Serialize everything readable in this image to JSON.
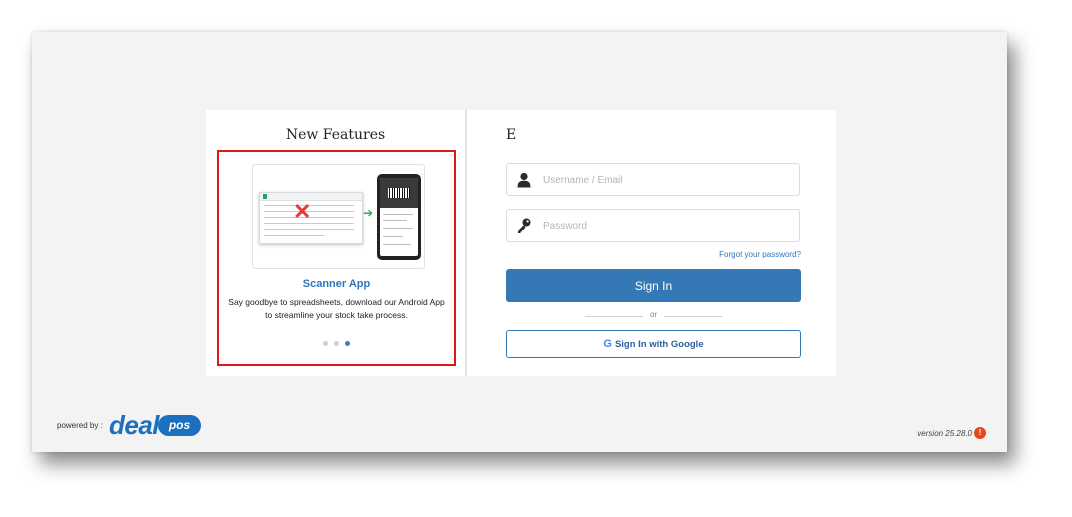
{
  "features": {
    "title": "New Features",
    "item_title": "Scanner App",
    "item_description": "Say goodbye to spreadsheets, download our Android App to streamline your stock take process.",
    "slide_count": 3,
    "active_slide": 3
  },
  "signin": {
    "brand_letter": "E",
    "username_placeholder": "Username / Email",
    "password_placeholder": "Password",
    "forgot_label": "Forgot your password?",
    "signin_label": "Sign In",
    "or_label": "or",
    "google_label": "Sign In with Google"
  },
  "footer": {
    "powered_by": "powered by :",
    "logo_deal": "deal",
    "logo_pos": "pos",
    "version": "version 25.28.0",
    "version_alert": "!"
  },
  "colors": {
    "accent": "#3478b6",
    "highlight_border": "#e01818",
    "link": "#2f77bb",
    "alert": "#e8461e"
  },
  "icons": [
    "user-icon",
    "key-icon",
    "google-icon",
    "arrow-right-icon",
    "red-x-icon",
    "barcode-icon"
  ]
}
